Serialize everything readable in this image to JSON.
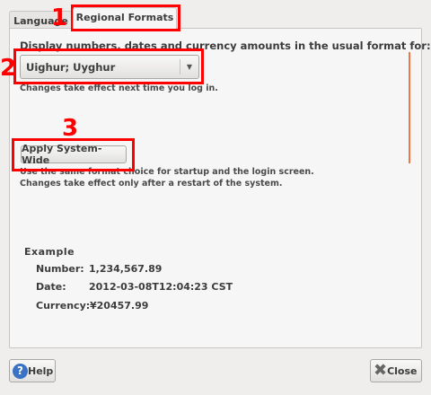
{
  "tabs": [
    {
      "label": "Language"
    },
    {
      "label": "Regional Formats"
    }
  ],
  "regional": {
    "prompt": "Display numbers, dates and currency amounts in the usual format for:",
    "format_value": "Uighur; Uyghur",
    "note": "Changes take effect next time you log in.",
    "apply_label": "Apply System-Wide",
    "apply_note1": "Use the same format choice for startup and the login screen.",
    "apply_note2": "Changes take effect only after a restart of the system."
  },
  "example": {
    "title": "Example",
    "rows": [
      {
        "label": "Number:",
        "value": "1,234,567.89"
      },
      {
        "label": "Date:",
        "value": "2012-03-08T12:04:23 CST"
      },
      {
        "label": "Currency:",
        "value": "¥20457.99"
      }
    ]
  },
  "footer": {
    "help_label": "Help",
    "close_label": "Close"
  },
  "annotations": [
    "1",
    "2",
    "3"
  ],
  "colors": {
    "annotation": "#ff0000",
    "scroll_accent": "#f07746"
  }
}
